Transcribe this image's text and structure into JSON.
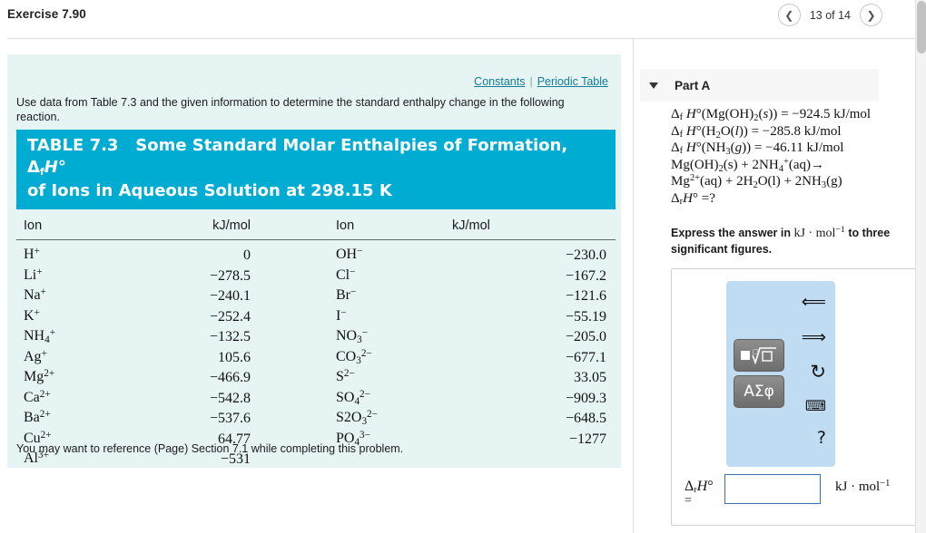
{
  "header": {
    "title": "Exercise 7.90",
    "pager": {
      "prev_icon": "chevron-left-icon",
      "next_icon": "chevron-right-icon",
      "count": "13 of 14"
    }
  },
  "problem": {
    "links": {
      "constants": "Constants",
      "separator": "|",
      "periodic_table": "Periodic Table"
    },
    "prompt": "Use data from Table 7.3 and the given information to determine the standard enthalpy change in the following reaction.",
    "footnote": "You may want to reference (Page) Section 7.1 while completing this problem."
  },
  "table": {
    "caption_line1": "TABLE 7.3   Some Standard Molar Enthalpies of Formation, ΔfH°",
    "caption_line2": "of Ions in Aqueous Solution at 298.15 K",
    "caption_number": "TABLE 7.3",
    "headers": {
      "ion": "Ion",
      "value": "kJ/mol"
    },
    "cations": [
      {
        "ion": "H+",
        "base": "H",
        "sub": "",
        "charge": "+",
        "value": "0"
      },
      {
        "ion": "Li+",
        "base": "Li",
        "sub": "",
        "charge": "+",
        "value": "−278.5"
      },
      {
        "ion": "Na+",
        "base": "Na",
        "sub": "",
        "charge": "+",
        "value": "−240.1"
      },
      {
        "ion": "K+",
        "base": "K",
        "sub": "",
        "charge": "+",
        "value": "−252.4"
      },
      {
        "ion": "NH4+",
        "base": "NH",
        "sub": "4",
        "charge": "+",
        "value": "−132.5"
      },
      {
        "ion": "Ag+",
        "base": "Ag",
        "sub": "",
        "charge": "+",
        "value": "105.6"
      },
      {
        "ion": "Mg2+",
        "base": "Mg",
        "sub": "",
        "charge": "2+",
        "value": "−466.9"
      },
      {
        "ion": "Ca2+",
        "base": "Ca",
        "sub": "",
        "charge": "2+",
        "value": "−542.8"
      },
      {
        "ion": "Ba2+",
        "base": "Ba",
        "sub": "",
        "charge": "2+",
        "value": "−537.6"
      },
      {
        "ion": "Cu2+",
        "base": "Cu",
        "sub": "",
        "charge": "2+",
        "value": "64.77"
      },
      {
        "ion": "Al3+",
        "base": "Al",
        "sub": "",
        "charge": "3+",
        "value": "−531"
      }
    ],
    "anions": [
      {
        "ion": "OH-",
        "base": "OH",
        "sub": "",
        "charge": "−",
        "value": "−230.0"
      },
      {
        "ion": "Cl-",
        "base": "Cl",
        "sub": "",
        "charge": "−",
        "value": "−167.2"
      },
      {
        "ion": "Br-",
        "base": "Br",
        "sub": "",
        "charge": "−",
        "value": "−121.6"
      },
      {
        "ion": "I-",
        "base": "I",
        "sub": "",
        "charge": "−",
        "value": "−55.19"
      },
      {
        "ion": "NO3-",
        "base": "NO",
        "sub": "3",
        "charge": "−",
        "value": "−205.0"
      },
      {
        "ion": "CO32-",
        "base": "CO",
        "sub": "3",
        "charge": "2−",
        "value": "−677.1"
      },
      {
        "ion": "S2-",
        "base": "S",
        "sub": "",
        "charge": "2−",
        "value": "33.05"
      },
      {
        "ion": "SO42-",
        "base": "SO",
        "sub": "4",
        "charge": "2−",
        "value": "−909.3"
      },
      {
        "ion": "S2O32-",
        "base": "S2O",
        "sub": "3",
        "charge": "2−",
        "value": "−648.5"
      },
      {
        "ion": "PO43-",
        "base": "PO",
        "sub": "4",
        "charge": "3−",
        "value": "−1277"
      }
    ]
  },
  "part_a": {
    "caret_icon": "caret-down-icon",
    "label": "Part A",
    "given": [
      "Δf H° (Mg(OH)2 (s)) = −924.5 kJ/mol",
      "Δf H° (H2O(l)) = −285.8 kJ/mol",
      "Δf H° (NH3(g)) = −46.11 kJ/mol",
      "Mg(OH)2 (s) + 2NH4+ (aq)→",
      "Mg2+ (aq) + 2H2O(l) + 2NH3 (g)",
      "ΔrH° =?"
    ],
    "given_values": {
      "mg_oh2_s": "−924.5 kJ/mol",
      "h2o_l": "−285.8 kJ/mol",
      "nh3_g": "−46.11 kJ/mol"
    },
    "instruction_prefix": "Express the answer in",
    "instruction_units": "kJ · mol",
    "instruction_exp": "−1",
    "instruction_suffix": "to three significant figures.",
    "palette": {
      "sqrt_button": "■√□",
      "greek_button": "ΑΣφ",
      "undo_icon": "undo-arrow-icon",
      "redo_icon": "redo-arrow-icon",
      "reset_icon": "reset-circular-arrow-icon",
      "keyboard_icon": "keyboard-icon",
      "help_icon": "question-mark-icon",
      "help_label": "?"
    },
    "answer": {
      "symbol_top": "ΔrH°",
      "symbol_eq": "=",
      "value": "",
      "placeholder": "",
      "units": "kJ · mol−1"
    }
  },
  "colors": {
    "table_header_blue": "#00acd2",
    "panel_cyan": "#e6f4f4",
    "link_teal": "#147d94",
    "palette_blue": "#bfdcf2",
    "input_border": "#3b6fb6"
  }
}
